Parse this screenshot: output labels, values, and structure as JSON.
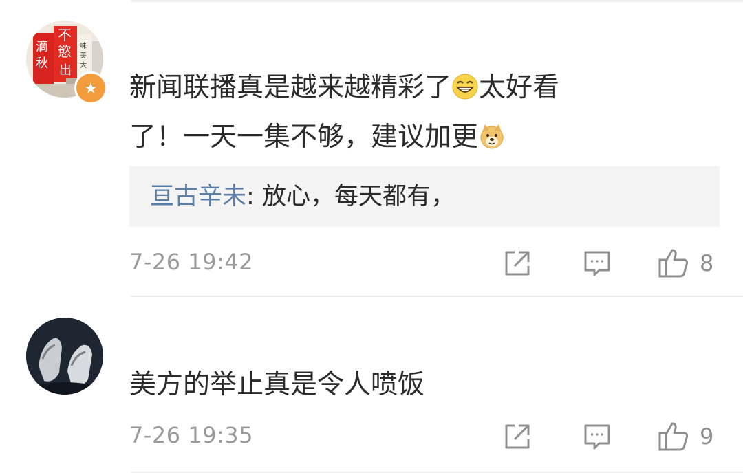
{
  "comments": [
    {
      "text_part1": "新闻联播真是越来越精彩了",
      "emoji1": "grinning-emoji",
      "text_part2": "太好看",
      "text_line2": "了！一天一集不够，建议加更",
      "emoji2": "doge-emoji",
      "reply": {
        "name": "亘古辛未",
        "colon": ":",
        "text": " 放心，每天都有，"
      },
      "time": "7-26 19:42",
      "likes": "8",
      "avatar_text": [
        "不",
        "慾",
        "滴",
        "秋",
        "出",
        "味",
        "美",
        "大"
      ]
    },
    {
      "text": "美方的举止真是令人喷饭",
      "time": "7-26 19:35",
      "likes": "9"
    }
  ],
  "icons": {
    "share": "share-icon",
    "comment": "comment-icon",
    "like": "thumbs-up-icon",
    "badge": "verified-badge-icon"
  },
  "colors": {
    "reply_name": "#5b7ea6",
    "meta_gray": "#9a9a9a",
    "reply_bg": "#f4f4f4",
    "badge": "#f39c3d"
  }
}
